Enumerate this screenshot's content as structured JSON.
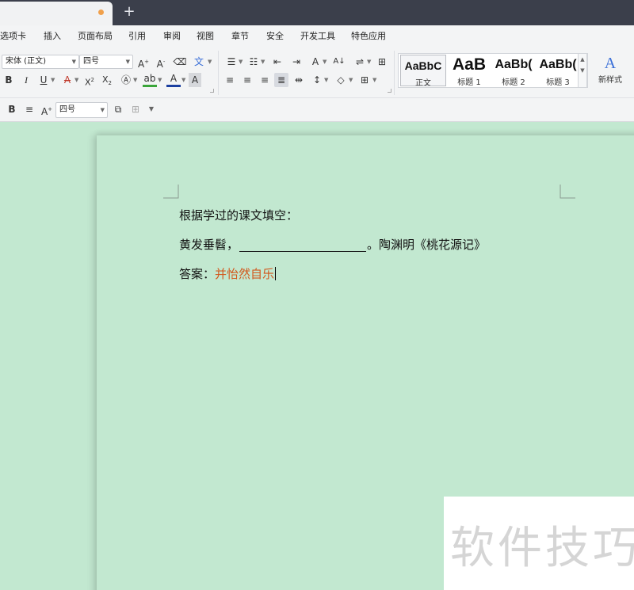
{
  "titlebar": {
    "new_tab_icon": "plus-icon",
    "tab_modified_dot_color": "#f0a04b"
  },
  "menu": {
    "items": [
      "选项卡",
      "插入",
      "页面布局",
      "引用",
      "审阅",
      "视图",
      "章节",
      "安全",
      "开发工具",
      "特色应用"
    ]
  },
  "ribbon": {
    "font_name": "宋体 (正文)",
    "font_size": "四号",
    "styles": [
      {
        "sample": "AaBbC",
        "label": "正文"
      },
      {
        "sample": "AaB",
        "label": "标题 1"
      },
      {
        "sample": "AaBb(",
        "label": "标题 2"
      },
      {
        "sample": "AaBb(",
        "label": "标题 3"
      }
    ],
    "new_style_label": "新样式"
  },
  "quickbar": {
    "font_size": "四号"
  },
  "document": {
    "line1": "根据学过的课文填空：",
    "line2_prefix": "黄发垂髫，",
    "line2_suffix": "。陶渊明《桃花源记》",
    "line3_label": "答案：",
    "line3_answer": "并怡然自乐",
    "answer_color": "#d2581c",
    "page_color": "#c2e8d0"
  },
  "watermark": {
    "text": "软件技巧"
  }
}
